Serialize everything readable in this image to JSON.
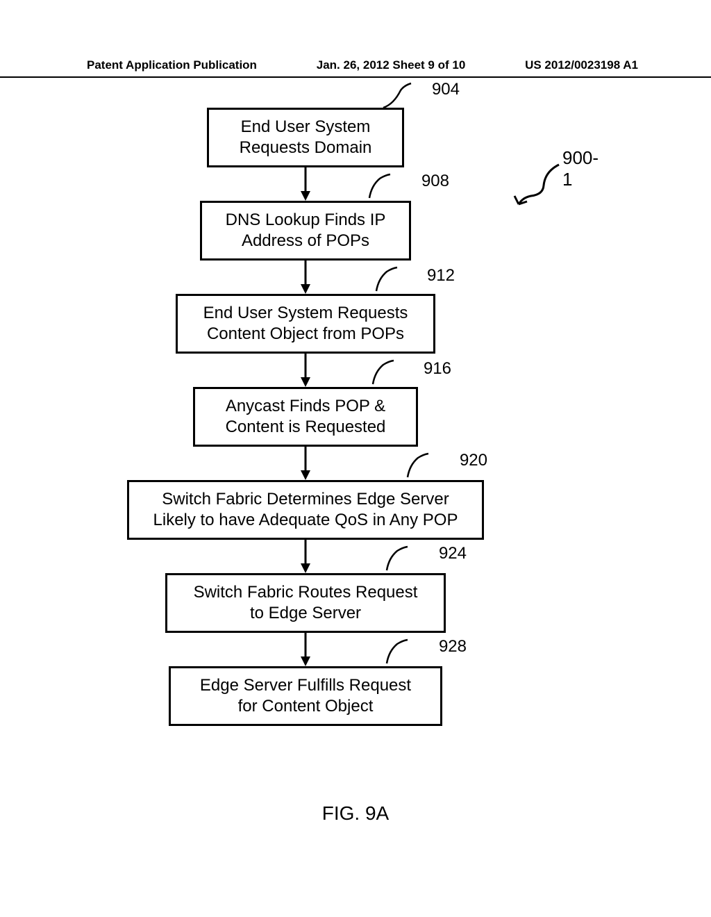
{
  "header": {
    "left": "Patent Application Publication",
    "center": "Jan. 26, 2012   Sheet 9 of 10",
    "right": "US 2012/0023198 A1"
  },
  "figure_label": "FIG. 9A",
  "overall_ref": "900-1",
  "steps": [
    {
      "ref": "904",
      "text": "End User System\nRequests Domain"
    },
    {
      "ref": "908",
      "text": "DNS Lookup Finds IP\nAddress of POPs"
    },
    {
      "ref": "912",
      "text": "End User System Requests\nContent Object from POPs"
    },
    {
      "ref": "916",
      "text": "Anycast Finds POP &\nContent is Requested"
    },
    {
      "ref": "920",
      "text": "Switch Fabric Determines Edge Server\nLikely to have Adequate QoS in Any POP"
    },
    {
      "ref": "924",
      "text": "Switch Fabric Routes Request\nto Edge Server"
    },
    {
      "ref": "928",
      "text": "Edge Server Fulfills Request\nfor Content Object"
    }
  ]
}
